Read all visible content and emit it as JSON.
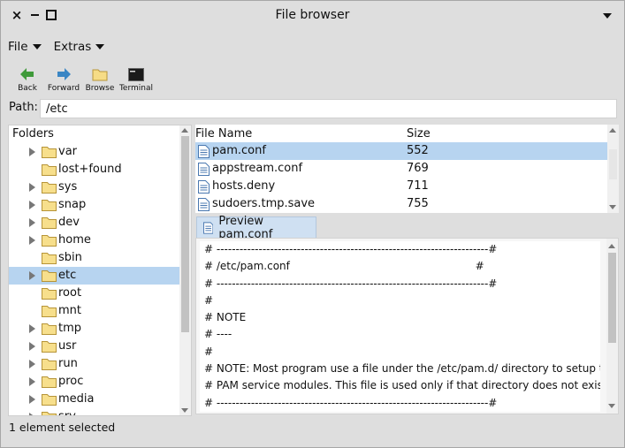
{
  "window": {
    "title": "File browser"
  },
  "menus": [
    "File",
    "Extras"
  ],
  "toolbar": {
    "back": "Back",
    "forward": "Forward",
    "browse": "Browse",
    "terminal": "Terminal"
  },
  "path": {
    "label": "Path:",
    "value": "/etc"
  },
  "folders": {
    "header": "Folders",
    "items": [
      {
        "name": "var",
        "expandable": true
      },
      {
        "name": "lost+found",
        "expandable": false
      },
      {
        "name": "sys",
        "expandable": true
      },
      {
        "name": "snap",
        "expandable": true
      },
      {
        "name": "dev",
        "expandable": true
      },
      {
        "name": "home",
        "expandable": true
      },
      {
        "name": "sbin",
        "expandable": false
      },
      {
        "name": "etc",
        "expandable": true,
        "selected": true
      },
      {
        "name": "root",
        "expandable": false
      },
      {
        "name": "mnt",
        "expandable": false
      },
      {
        "name": "tmp",
        "expandable": true
      },
      {
        "name": "usr",
        "expandable": true
      },
      {
        "name": "run",
        "expandable": true
      },
      {
        "name": "proc",
        "expandable": true
      },
      {
        "name": "media",
        "expandable": true
      },
      {
        "name": "srv",
        "expandable": true
      }
    ]
  },
  "files": {
    "columns": [
      "File Name",
      "Size"
    ],
    "rows": [
      {
        "name": "pam.conf",
        "size": "552",
        "selected": true
      },
      {
        "name": "appstream.conf",
        "size": "769"
      },
      {
        "name": "hosts.deny",
        "size": "711"
      },
      {
        "name": "sudoers.tmp.save",
        "size": "755"
      }
    ]
  },
  "preview": {
    "tab_label": "Preview pam.conf",
    "lines": [
      "# -----------------------------------------------------------------------#",
      "# /etc/pam.conf                                                       #",
      "# -----------------------------------------------------------------------#",
      "#",
      "# NOTE",
      "# ----",
      "#",
      "# NOTE: Most program use a file under the /etc/pam.d/ directory to setup their",
      "# PAM service modules. This file is used only if that directory does not exist.",
      "# -----------------------------------------------------------------------#"
    ]
  },
  "status": "1 element selected",
  "colors": {
    "selection": "#b7d4f0",
    "window_bg": "#dedede",
    "tab_bg": "#cfe0f2"
  }
}
